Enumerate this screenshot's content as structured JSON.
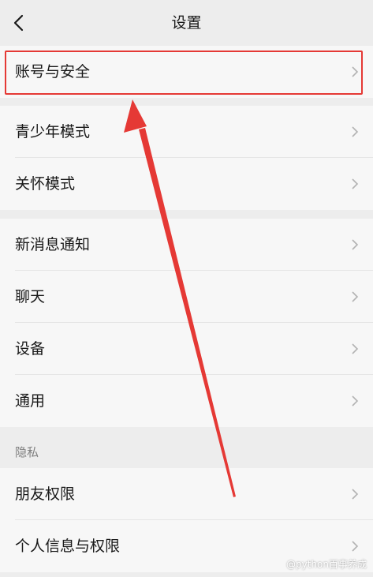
{
  "header": {
    "title": "设置"
  },
  "groups": [
    {
      "items": [
        {
          "label": "账号与安全"
        }
      ]
    },
    {
      "items": [
        {
          "label": "青少年模式"
        },
        {
          "label": "关怀模式"
        }
      ]
    },
    {
      "items": [
        {
          "label": "新消息通知"
        },
        {
          "label": "聊天"
        },
        {
          "label": "设备"
        },
        {
          "label": "通用"
        }
      ]
    },
    {
      "items": [
        {
          "label": "朋友权限"
        },
        {
          "label": "个人信息与权限"
        }
      ]
    }
  ],
  "section_privacy": "隐私",
  "watermark": "@python百事养成",
  "colors": {
    "annotation": "#e53935",
    "background": "#ededed",
    "cell": "#f7f7f7"
  }
}
